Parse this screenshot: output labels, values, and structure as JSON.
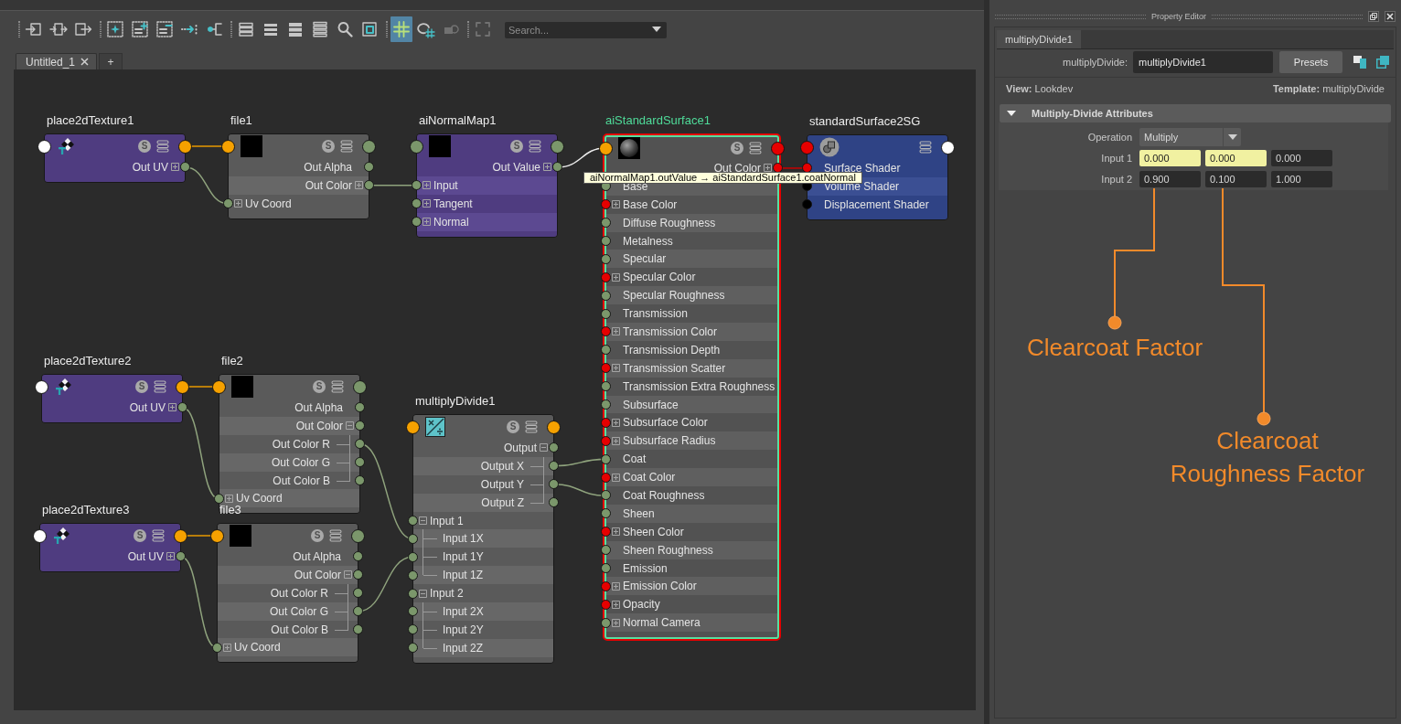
{
  "toolbar": {
    "tools": [
      {
        "selected": false,
        "disabled": false
      },
      {
        "selected": false,
        "disabled": false
      },
      {
        "selected": false,
        "disabled": false
      },
      {
        "selected": false,
        "disabled": false
      },
      {
        "selected": false,
        "disabled": false
      },
      {
        "selected": false,
        "disabled": false
      },
      {
        "selected": false,
        "disabled": false
      },
      {
        "selected": false,
        "disabled": false
      },
      {
        "selected": false,
        "disabled": false
      },
      {
        "selected": false,
        "disabled": false
      },
      {
        "selected": false,
        "disabled": false
      },
      {
        "selected": false,
        "disabled": false
      },
      {
        "selected": false,
        "disabled": false
      },
      {
        "selected": false,
        "disabled": false
      },
      {
        "selected": true,
        "disabled": false
      },
      {
        "selected": false,
        "disabled": false
      },
      {
        "selected": false,
        "disabled": true
      },
      {
        "selected": false,
        "disabled": true
      }
    ],
    "search": {
      "placeholder": "Search..."
    }
  },
  "tabs": [
    {
      "label": "Untitled_1",
      "selected": true
    }
  ],
  "new_tab_button": "+",
  "graph": {
    "nodes": [
      {
        "name": "place2dTexture1",
        "kind": "placement",
        "selected": false,
        "badge": "S",
        "input_port": {
          "color": "#ffffff"
        },
        "output_port": {
          "color": "#f6a100"
        },
        "attributes": [
          {
            "label": "Out UV",
            "kind": "output",
            "expanded": false,
            "color": "#7b976b"
          }
        ]
      },
      {
        "name": "file1",
        "kind": "file",
        "selected": false,
        "badge": "S",
        "input_port": {
          "color": "#f6a100"
        },
        "output_port": {
          "color": "#7b976b"
        },
        "attributes": [
          {
            "label": "Out Alpha",
            "kind": "output",
            "color": "#7b976b"
          },
          {
            "label": "Out Color",
            "kind": "output",
            "expanded": false,
            "color": "#7b976b"
          },
          {
            "label": "Uv Coord",
            "kind": "input",
            "expanded": false,
            "color": "#7b976b"
          }
        ]
      },
      {
        "name": "aiNormalMap1",
        "kind": "normal_map",
        "selected": false,
        "badge": "S",
        "input_port": {
          "color": "#7b976b"
        },
        "output_port": {
          "color": "#7b976b"
        },
        "attributes": [
          {
            "label": "Out Value",
            "kind": "output",
            "expanded": false,
            "color": "#7b976b"
          },
          {
            "label": "Input",
            "kind": "input",
            "expanded": false,
            "color": "#7b976b"
          },
          {
            "label": "Tangent",
            "kind": "input",
            "expanded": false,
            "color": "#7b976b"
          },
          {
            "label": "Normal",
            "kind": "input",
            "expanded": false,
            "color": "#7b976b"
          }
        ]
      },
      {
        "name": "aiStandardSurface1",
        "kind": "shader",
        "selected": true,
        "badge": "S",
        "input_port": {
          "color": "#f6a100"
        },
        "output_port": {
          "color": "#e60000"
        },
        "attributes": [
          {
            "label": "Out Color",
            "kind": "output",
            "expanded": false,
            "color": "#e60000"
          },
          {
            "label": "Base",
            "kind": "input",
            "color": "#7b976b"
          },
          {
            "label": "Base Color",
            "kind": "input",
            "expanded": false,
            "color": "#e60000"
          },
          {
            "label": "Diffuse Roughness",
            "kind": "input",
            "color": "#7b976b"
          },
          {
            "label": "Metalness",
            "kind": "input",
            "color": "#7b976b"
          },
          {
            "label": "Specular",
            "kind": "input",
            "color": "#7b976b"
          },
          {
            "label": "Specular Color",
            "kind": "input",
            "expanded": false,
            "color": "#e60000"
          },
          {
            "label": "Specular Roughness",
            "kind": "input",
            "color": "#7b976b"
          },
          {
            "label": "Transmission",
            "kind": "input",
            "color": "#7b976b"
          },
          {
            "label": "Transmission Color",
            "kind": "input",
            "expanded": false,
            "color": "#e60000"
          },
          {
            "label": "Transmission Depth",
            "kind": "input",
            "color": "#7b976b"
          },
          {
            "label": "Transmission Scatter",
            "kind": "input",
            "expanded": false,
            "color": "#e60000"
          },
          {
            "label": "Transmission Extra Roughness",
            "kind": "input",
            "color": "#7b976b"
          },
          {
            "label": "Subsurface",
            "kind": "input",
            "color": "#7b976b"
          },
          {
            "label": "Subsurface Color",
            "kind": "input",
            "expanded": false,
            "color": "#e60000"
          },
          {
            "label": "Subsurface Radius",
            "kind": "input",
            "expanded": false,
            "color": "#e60000"
          },
          {
            "label": "Coat",
            "kind": "input",
            "color": "#7b976b"
          },
          {
            "label": "Coat Color",
            "kind": "input",
            "expanded": false,
            "color": "#e60000"
          },
          {
            "label": "Coat Roughness",
            "kind": "input",
            "color": "#7b976b"
          },
          {
            "label": "Sheen",
            "kind": "input",
            "color": "#7b976b"
          },
          {
            "label": "Sheen Color",
            "kind": "input",
            "expanded": false,
            "color": "#e60000"
          },
          {
            "label": "Sheen Roughness",
            "kind": "input",
            "color": "#7b976b"
          },
          {
            "label": "Emission",
            "kind": "input",
            "color": "#7b976b"
          },
          {
            "label": "Emission Color",
            "kind": "input",
            "expanded": false,
            "color": "#e60000"
          },
          {
            "label": "Opacity",
            "kind": "input",
            "expanded": false,
            "color": "#e60000"
          },
          {
            "label": "Normal Camera",
            "kind": "input",
            "expanded": false,
            "color": "#7b976b"
          }
        ]
      },
      {
        "name": "standardSurface2SG",
        "kind": "shading_group",
        "selected": false,
        "input_port": {
          "color": "#e60000"
        },
        "output_port": {
          "color": "#ffffff"
        },
        "attributes": [
          {
            "label": "Surface Shader",
            "kind": "input",
            "color": "#e60000"
          },
          {
            "label": "Volume Shader",
            "kind": "input",
            "color": "#000000"
          },
          {
            "label": "Displacement Shader",
            "kind": "input",
            "color": "#000000"
          }
        ]
      },
      {
        "name": "place2dTexture2",
        "kind": "placement",
        "selected": false,
        "badge": "S",
        "input_port": {
          "color": "#ffffff"
        },
        "output_port": {
          "color": "#f6a100"
        },
        "attributes": [
          {
            "label": "Out UV",
            "kind": "output",
            "expanded": false,
            "color": "#7b976b"
          }
        ]
      },
      {
        "name": "file2",
        "kind": "file",
        "selected": false,
        "badge": "S",
        "input_port": {
          "color": "#f6a100"
        },
        "output_port": {
          "color": "#7b976b"
        },
        "attributes": [
          {
            "label": "Out Alpha",
            "kind": "output",
            "color": "#7b976b"
          },
          {
            "label": "Out Color",
            "kind": "output",
            "expanded": true,
            "color": "#7b976b",
            "children": [
              {
                "label": "Out Color R",
                "kind": "output",
                "color": "#7b976b"
              },
              {
                "label": "Out Color G",
                "kind": "output",
                "color": "#7b976b"
              },
              {
                "label": "Out Color B",
                "kind": "output",
                "color": "#7b976b"
              }
            ]
          },
          {
            "label": "Uv Coord",
            "kind": "input",
            "expanded": false,
            "color": "#7b976b"
          }
        ]
      },
      {
        "name": "multiplyDivide1",
        "kind": "math",
        "selected": false,
        "badge": "S",
        "input_port": {
          "color": "#f6a100"
        },
        "output_port": {
          "color": "#f6a100"
        },
        "attributes": [
          {
            "label": "Output",
            "kind": "output",
            "expanded": true,
            "color": "#7b976b",
            "children": [
              {
                "label": "Output X",
                "kind": "output",
                "color": "#7b976b"
              },
              {
                "label": "Output Y",
                "kind": "output",
                "color": "#7b976b"
              },
              {
                "label": "Output Z",
                "kind": "output",
                "color": "#7b976b"
              }
            ]
          },
          {
            "label": "Input 1",
            "kind": "input",
            "expanded": true,
            "color": "#7b976b",
            "children": [
              {
                "label": "Input 1X",
                "kind": "input",
                "color": "#7b976b"
              },
              {
                "label": "Input 1Y",
                "kind": "input",
                "color": "#7b976b"
              },
              {
                "label": "Input 1Z",
                "kind": "input",
                "color": "#7b976b"
              }
            ]
          },
          {
            "label": "Input 2",
            "kind": "input",
            "expanded": true,
            "color": "#7b976b",
            "children": [
              {
                "label": "Input 2X",
                "kind": "input",
                "color": "#7b976b"
              },
              {
                "label": "Input 2Y",
                "kind": "input",
                "color": "#7b976b"
              },
              {
                "label": "Input 2Z",
                "kind": "input",
                "color": "#7b976b"
              }
            ]
          }
        ]
      },
      {
        "name": "place2dTexture3",
        "kind": "placement",
        "selected": false,
        "badge": "S",
        "input_port": {
          "color": "#ffffff"
        },
        "output_port": {
          "color": "#f6a100"
        },
        "attributes": [
          {
            "label": "Out UV",
            "kind": "output",
            "expanded": false,
            "color": "#7b976b"
          }
        ]
      },
      {
        "name": "file3",
        "kind": "file",
        "selected": false,
        "badge": "S",
        "input_port": {
          "color": "#f6a100"
        },
        "output_port": {
          "color": "#7b976b"
        },
        "attributes": [
          {
            "label": "Out Alpha",
            "kind": "output",
            "color": "#7b976b"
          },
          {
            "label": "Out Color",
            "kind": "output",
            "expanded": true,
            "color": "#7b976b",
            "children": [
              {
                "label": "Out Color R",
                "kind": "output",
                "color": "#7b976b"
              },
              {
                "label": "Out Color G",
                "kind": "output",
                "color": "#7b976b"
              },
              {
                "label": "Out Color B",
                "kind": "output",
                "color": "#7b976b"
              }
            ]
          },
          {
            "label": "Uv Coord",
            "kind": "input",
            "expanded": false,
            "color": "#7b976b"
          }
        ]
      }
    ],
    "tooltip": "aiNormalMap1.outValue → aiStandardSurface1.coatNormal"
  },
  "property_editor": {
    "title": "Property Editor",
    "tabs": [
      {
        "label": "multiplyDivide1",
        "selected": true
      }
    ],
    "node_type_label": "multiplyDivide:",
    "node_name": "multiplyDivide1",
    "presets_button": "Presets",
    "view": "**View:** Lookdev",
    "template": "**Template:** multiplyDivide",
    "sections": [
      {
        "title": "Multiply-Divide Attributes",
        "expanded": true,
        "fields": [
          {
            "kind": "dropdown",
            "label": "Operation",
            "value": "Multiply"
          },
          {
            "kind": "vector",
            "label": "Input 1",
            "values": [
              {
                "value": "0.000",
                "connected": true
              },
              {
                "value": "0.000",
                "connected": true
              },
              {
                "value": "0.000",
                "connected": false
              }
            ]
          },
          {
            "kind": "vector",
            "label": "Input 2",
            "values": [
              {
                "value": "0.900",
                "connected": false
              },
              {
                "value": "0.100",
                "connected": false
              },
              {
                "value": "1.000",
                "connected": false
              }
            ]
          }
        ]
      }
    ]
  },
  "callouts": [
    {
      "text": "Clearcoat Factor"
    },
    {
      "text": "Clearcoat Roughness Factor"
    }
  ]
}
